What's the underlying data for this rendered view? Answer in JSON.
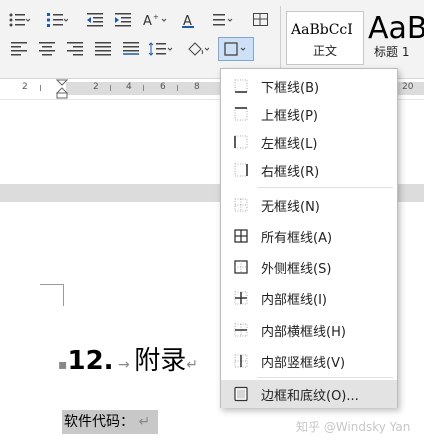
{
  "ribbon": {
    "styles": [
      {
        "sample": "AaBbCcI",
        "name": "正文"
      },
      {
        "sample": "AaB",
        "name": "标题 1"
      }
    ]
  },
  "ruler": {
    "marks": [
      "2",
      "2",
      "4",
      "6",
      "8",
      "20"
    ]
  },
  "document": {
    "heading_number": "12.",
    "heading_title": "附录",
    "code_line": "软件代码："
  },
  "border_menu": {
    "items": [
      {
        "label": "下框线(B)",
        "icon": "bottom-border-icon"
      },
      {
        "label": "上框线(P)",
        "icon": "top-border-icon"
      },
      {
        "label": "左框线(L)",
        "icon": "left-border-icon"
      },
      {
        "label": "右框线(R)",
        "icon": "right-border-icon"
      },
      {
        "label": "无框线(N)",
        "icon": "no-border-icon"
      },
      {
        "label": "所有框线(A)",
        "icon": "all-borders-icon"
      },
      {
        "label": "外侧框线(S)",
        "icon": "outside-borders-icon"
      },
      {
        "label": "内部框线(I)",
        "icon": "inside-borders-icon"
      },
      {
        "label": "内部横框线(H)",
        "icon": "inside-horizontal-border-icon"
      },
      {
        "label": "内部竖框线(V)",
        "icon": "inside-vertical-border-icon"
      },
      {
        "label": "边框和底纹(O)...",
        "icon": "borders-and-shading-icon",
        "highlighted": true
      }
    ]
  },
  "watermark": "知乎 @Windsky Yan",
  "colors": {
    "ribbon_bg": "#f3f3f3",
    "menu_highlight": "#e3e3e3",
    "text_shading": "#c8c8c8",
    "page_gap": "#dcdcdc"
  }
}
